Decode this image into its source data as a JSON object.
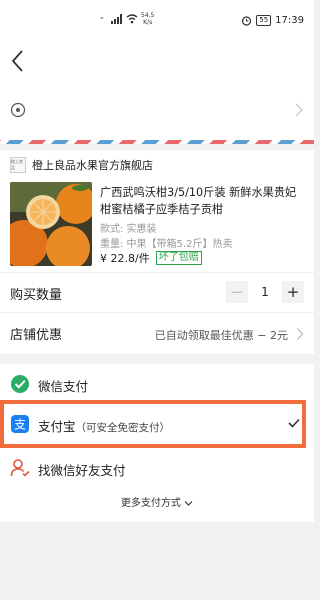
{
  "status_bar": {
    "network_speed": "54.5",
    "network_unit": "K/s",
    "battery": "55",
    "time": "17:39"
  },
  "shop": {
    "logo_text": "橙上良品",
    "name": "橙上良品水果官方旗舰店"
  },
  "product": {
    "title": "广西武鸣沃柑3/5/10斤装 新鲜水果贵妃柑蜜桔橘子应季桔子贡柑",
    "spec": "款式: 实惠装",
    "weight": "重量: 中果【带箱5.2斤】热卖",
    "price": "¥ 22.8/件",
    "badge": "坏了包赔"
  },
  "quantity": {
    "label": "购买数量",
    "value": "1",
    "minus": "−",
    "plus": "+"
  },
  "discount": {
    "label": "店铺优惠",
    "value": "已自动领取最佳优惠 − 2元"
  },
  "payment": {
    "wechat": "微信支付",
    "alipay": "支付宝",
    "alipay_sub": "（可安全免密支付）",
    "friend": "找微信好友支付",
    "more": "更多支付方式",
    "selected": "alipay",
    "accent_highlight": "#f26b3a",
    "wechat_color": "#2aae67",
    "alipay_color": "#1c7ff0",
    "friend_color": "#e0563e"
  }
}
